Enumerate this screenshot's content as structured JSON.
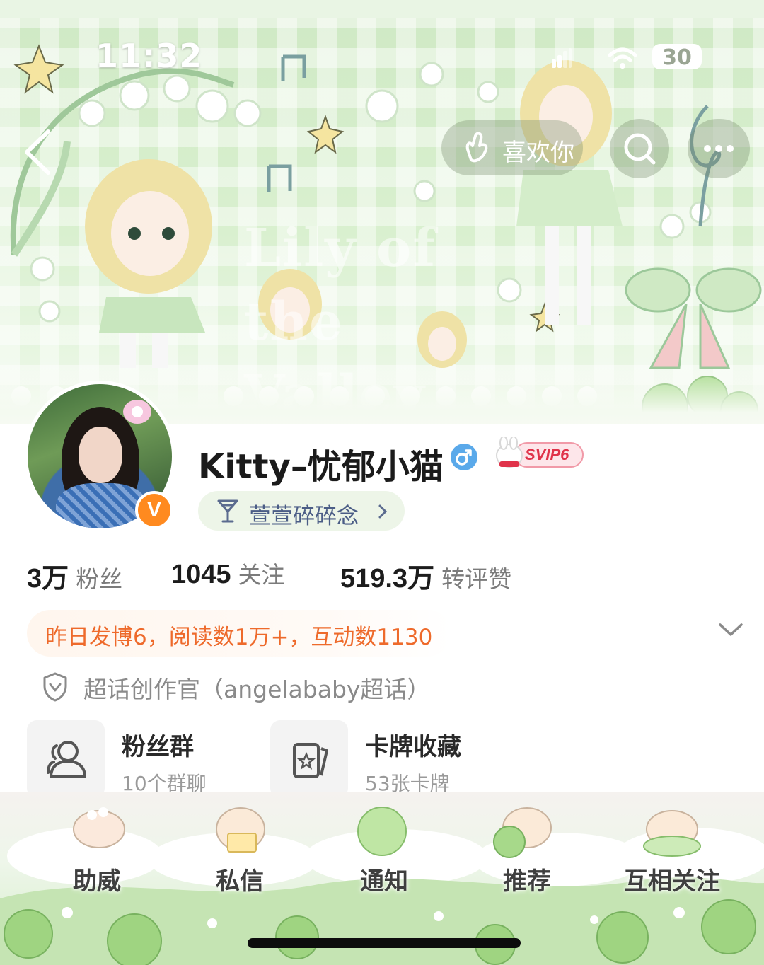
{
  "status_bar": {
    "time": "11:32",
    "battery": "30"
  },
  "banner": {
    "watermark_text": "Lily of the Valley",
    "like_label": "喜欢你"
  },
  "profile": {
    "username": "Kitty–忧郁小猫",
    "verified_badge": "V",
    "svip_label": "SVIP6",
    "tag_label": "萱萱碎碎念"
  },
  "stats": [
    {
      "value": "3万",
      "label": "粉丝"
    },
    {
      "value": "1045",
      "label": "关注"
    },
    {
      "value": "519.3万",
      "label": "转评赞"
    }
  ],
  "yesterday_summary": "昨日发博6，阅读数1万+，互动数1130",
  "super_topic": "超话创作官（angelababy超话）",
  "cards": [
    {
      "title": "粉丝群",
      "subtitle": "10个群聊",
      "icon": "group-icon"
    },
    {
      "title": "卡牌收藏",
      "subtitle": "53张卡牌",
      "icon": "card-icon"
    }
  ],
  "bottom_nav": [
    {
      "label": "助威"
    },
    {
      "label": "私信"
    },
    {
      "label": "通知"
    },
    {
      "label": "推荐"
    },
    {
      "label": "互相关注"
    }
  ],
  "colors": {
    "accent_orange": "#ee6a2b",
    "vip_badge": "#ff8a1f",
    "banner_green": "#d9f0cf",
    "tag_text": "#4b5d86"
  }
}
